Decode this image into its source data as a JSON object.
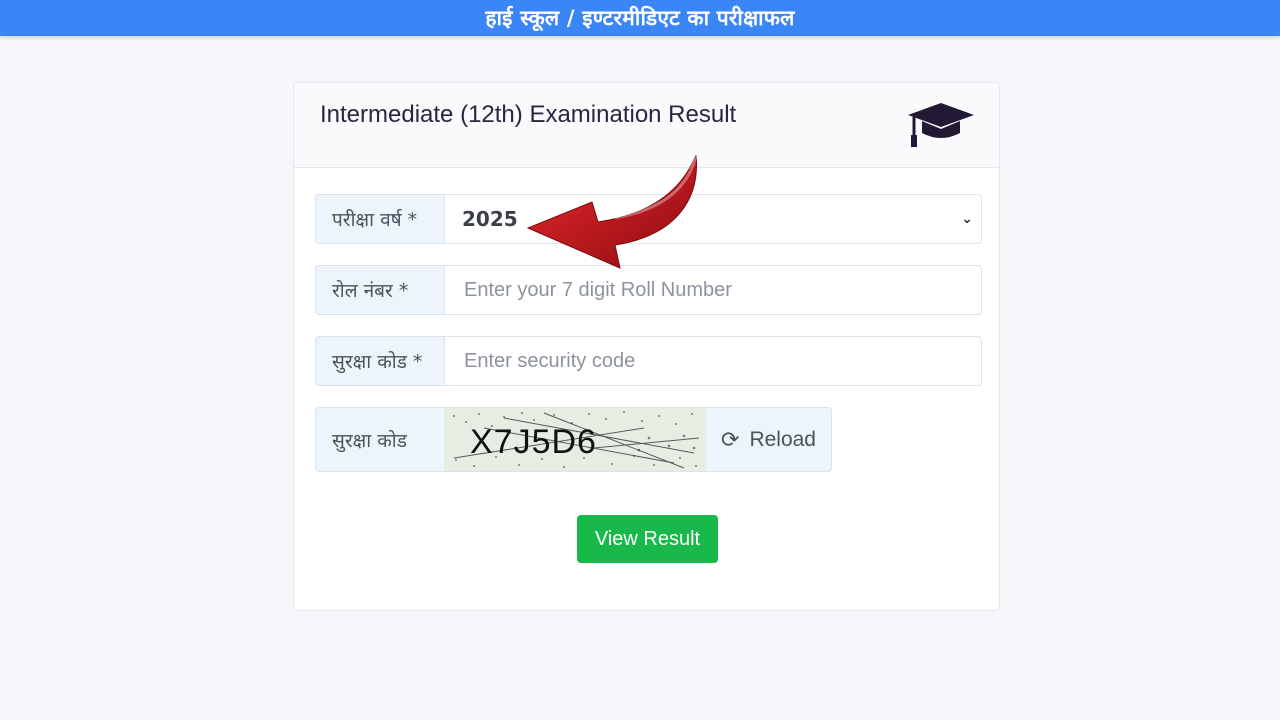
{
  "header": {
    "title": "हाई स्कूल / इण्टरमीडिएट का परीक्षाफल"
  },
  "card": {
    "title": "Intermediate (12th) Examination Result",
    "icon": "graduation-cap-icon"
  },
  "form": {
    "year_label": "परीक्षा वर्ष *",
    "year_value": "2025",
    "roll_label": "रोल नंबर *",
    "roll_placeholder": "Enter your 7 digit Roll Number",
    "security_label": "सुरक्षा कोड *",
    "security_placeholder": "Enter security code",
    "captcha_label": "सुरक्षा कोड",
    "captcha_text": "X7J5D6",
    "reload_label": "Reload",
    "submit_label": "View Result"
  },
  "colors": {
    "topbar": "#3b86f7",
    "submit": "#18b84a",
    "arrow": "#c8171c"
  }
}
